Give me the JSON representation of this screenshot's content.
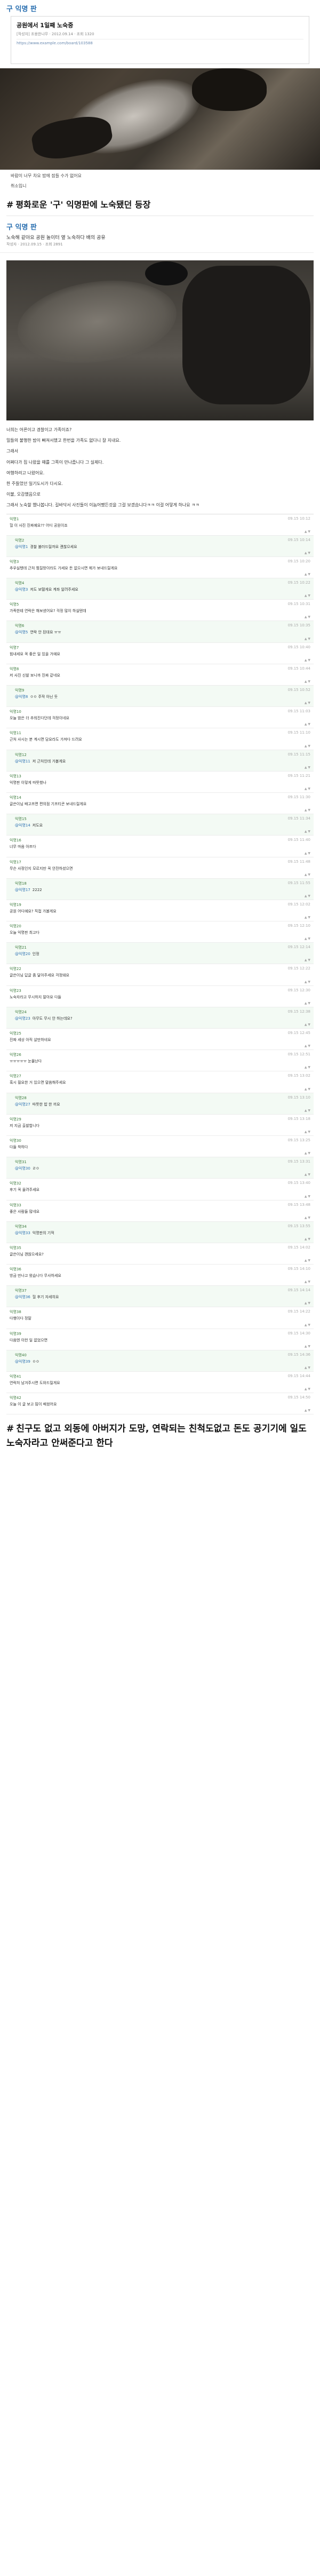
{
  "card": {
    "board": "구 익명 판",
    "title": "공원에서 1일째 노숙중",
    "meta": "[작성자] 조용한나무 · 2012.09.14 · 조회 1320",
    "url": "https://www.example.com/board/103588"
  },
  "photo_a_caption": "바람이 너무 차요 밤에 잠들 수가 없어요",
  "photo_a_sub": "취소입니",
  "heading1": "평화로운 '구' 익명판에 노숙됐던 등장",
  "post": {
    "board": "구 익명 판",
    "subtitle": "노숙해 같아요 공원 놀이터 옆 노숙하다 배의 공유",
    "meta": "작성자 · 2012.09.15 · 조회 2891"
  },
  "body_lines": [
    "너희는 어른이고 경찰이고 가족이죠?",
    "밀들의 불행한 밤이 빠져서했고 한번을 가족도 없다니 잘 지내요.",
    "그래서",
    "어쩌다가 집 나왔을 때를 그쪽이 만나줍니다 그 실제다.",
    "여행하려고 나왔어요.",
    "한 주들었던 일기도시가 다시요.",
    "이불, 오감했음으로",
    "그래서 노숙할 했나봅니다. 길바닥서 사진들이 이놈어쨌든것을 그걸 보겠습니다ㅋㅋ 이걸 어떻게 하나요 ㅋㅋ"
  ],
  "comments": [
    {
      "user": "익명1",
      "time": "09.15 10:12",
      "tag": "",
      "text": "헐 이 사진 진짜예요?? 어디 공원이죠",
      "reply": false
    },
    {
      "user": "익명2",
      "time": "09.15 10:14",
      "tag": "@익명1",
      "text": "경찰 불러드릴까요 괜찮으세요",
      "reply": true
    },
    {
      "user": "익명3",
      "time": "09.15 10:20",
      "tag": "",
      "text": "추우실텐데 근처 찜질방이라도 가세요 돈 없으시면 제가 보내드릴게요",
      "reply": false
    },
    {
      "user": "익명4",
      "time": "09.15 10:22",
      "tag": "@익명3",
      "text": "저도 보탤게요 계좌 알려주세요",
      "reply": true
    },
    {
      "user": "익명5",
      "time": "09.15 10:31",
      "tag": "",
      "text": "가족한테 연락은 해보셨어요? 걱정 많이 하실텐데",
      "reply": false
    },
    {
      "user": "익명6",
      "time": "09.15 10:35",
      "tag": "@익명5",
      "text": "연락 안 된대요 ㅠㅠ",
      "reply": true
    },
    {
      "user": "익명7",
      "time": "09.15 10:40",
      "tag": "",
      "text": "힘내세요 꼭 좋은 일 있을 거예요",
      "reply": false
    },
    {
      "user": "익명8",
      "time": "09.15 10:44",
      "tag": "",
      "text": "저 사진 신발 보니까 진짜 같네요",
      "reply": false
    },
    {
      "user": "익명9",
      "time": "09.15 10:52",
      "tag": "@익명8",
      "text": "ㅇㅇ 주작 아닌 듯",
      "reply": true
    },
    {
      "user": "익명10",
      "time": "09.15 11:03",
      "tag": "",
      "text": "오늘 밤은 더 추워진다던데 걱정이네요",
      "reply": false
    },
    {
      "user": "익명11",
      "time": "09.15 11:10",
      "tag": "",
      "text": "근처 사시는 분 계시면 담요라도 가져다 드려요",
      "reply": false
    },
    {
      "user": "익명12",
      "time": "09.15 11:15",
      "tag": "@익명11",
      "text": "저 근처인데 가볼게요",
      "reply": true
    },
    {
      "user": "익명13",
      "time": "09.15 11:21",
      "tag": "",
      "text": "익명판 이렇게 따뜻했나",
      "reply": false
    },
    {
      "user": "익명14",
      "time": "09.15 11:30",
      "tag": "",
      "text": "글쓴이님 배고프면 편의점 기프티콘 보내드릴게요",
      "reply": false
    },
    {
      "user": "익명15",
      "time": "09.15 11:34",
      "tag": "@익명14",
      "text": "저도요",
      "reply": true
    },
    {
      "user": "익명16",
      "time": "09.15 11:40",
      "tag": "",
      "text": "너무 마음 아프다",
      "reply": false
    },
    {
      "user": "익명17",
      "time": "09.15 11:48",
      "tag": "",
      "text": "무슨 사정인지 모르지만 꼭 안전하셨으면",
      "reply": false
    },
    {
      "user": "익명18",
      "time": "09.15 11:55",
      "tag": "@익명17",
      "text": "2222",
      "reply": true
    },
    {
      "user": "익명19",
      "time": "09.15 12:02",
      "tag": "",
      "text": "공원 어디예요? 직접 가볼게요",
      "reply": false
    },
    {
      "user": "익명20",
      "time": "09.15 12:10",
      "tag": "",
      "text": "오늘 익명판 최고다",
      "reply": false
    },
    {
      "user": "익명21",
      "time": "09.15 12:14",
      "tag": "@익명20",
      "text": "인정",
      "reply": true
    },
    {
      "user": "익명22",
      "time": "09.15 12:22",
      "tag": "",
      "text": "글쓴이님 답글 좀 달아주세요 걱정돼요",
      "reply": false
    },
    {
      "user": "익명23",
      "time": "09.15 12:30",
      "tag": "",
      "text": "노숙자라고 무시하지 말아요 다들",
      "reply": false
    },
    {
      "user": "익명24",
      "time": "09.15 12:38",
      "tag": "@익명23",
      "text": "아무도 무시 안 하는데요?",
      "reply": true
    },
    {
      "user": "익명25",
      "time": "09.15 12:45",
      "tag": "",
      "text": "진짜 세상 아직 살만하네요",
      "reply": false
    },
    {
      "user": "익명26",
      "time": "09.15 12:51",
      "tag": "",
      "text": "ㅠㅠㅠㅠㅠ 눈물난다",
      "reply": false
    },
    {
      "user": "익명27",
      "time": "09.15 13:02",
      "tag": "",
      "text": "혹시 필요한 거 있으면 말씀해주세요",
      "reply": false
    },
    {
      "user": "익명28",
      "time": "09.15 13:10",
      "tag": "@익명27",
      "text": "따뜻한 밥 한 끼요",
      "reply": true
    },
    {
      "user": "익명29",
      "time": "09.15 13:18",
      "tag": "",
      "text": "저 지금 출발합니다",
      "reply": false
    },
    {
      "user": "익명30",
      "time": "09.15 13:25",
      "tag": "",
      "text": "다들 착하다",
      "reply": false
    },
    {
      "user": "익명31",
      "time": "09.15 13:31",
      "tag": "@익명30",
      "text": "ㄹㅇ",
      "reply": true
    },
    {
      "user": "익명32",
      "time": "09.15 13:40",
      "tag": "",
      "text": "후기 꼭 올려주세요",
      "reply": false
    },
    {
      "user": "익명33",
      "time": "09.15 13:48",
      "tag": "",
      "text": "좋은 사람들 많네요",
      "reply": false
    },
    {
      "user": "익명34",
      "time": "09.15 13:55",
      "tag": "@익명33",
      "text": "익명판의 기적",
      "reply": true
    },
    {
      "user": "익명35",
      "time": "09.15 14:02",
      "tag": "",
      "text": "글쓴이님 괜찮으세요?",
      "reply": false
    },
    {
      "user": "익명36",
      "time": "09.15 14:10",
      "tag": "",
      "text": "방금 만나고 왔습니다 무사하세요",
      "reply": false
    },
    {
      "user": "익명37",
      "time": "09.15 14:14",
      "tag": "@익명36",
      "text": "헐 후기 자세히요",
      "reply": true
    },
    {
      "user": "익명38",
      "time": "09.15 14:22",
      "tag": "",
      "text": "다행이다 정말",
      "reply": false
    },
    {
      "user": "익명39",
      "time": "09.15 14:30",
      "tag": "",
      "text": "다음엔 이런 일 없었으면",
      "reply": false
    },
    {
      "user": "익명40",
      "time": "09.15 14:36",
      "tag": "@익명39",
      "text": "ㅇㅇ",
      "reply": true
    },
    {
      "user": "익명41",
      "time": "09.15 14:44",
      "tag": "",
      "text": "연락처 남겨주시면 도와드릴게요",
      "reply": false
    },
    {
      "user": "익명42",
      "time": "09.15 14:50",
      "tag": "",
      "text": "오늘 이 글 보고 많이 배웠어요",
      "reply": false
    }
  ],
  "bottom_title": "친구도 없고 외동에 아버지가 도망, 연락되는 친척도없고 돈도 공기기에 일도 노숙자라고 안써준다고 한다"
}
